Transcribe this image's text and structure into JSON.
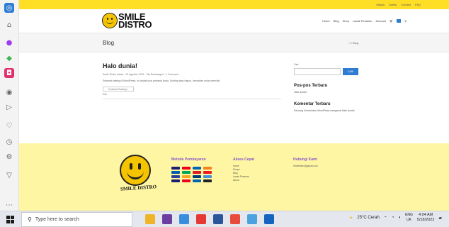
{
  "topbar": {
    "links": [
      "Masuk",
      "Daftar",
      "Contact",
      "FAQ"
    ]
  },
  "logo": {
    "text_line1": "SMILE",
    "text_line2": "DISTRO"
  },
  "nav": {
    "items": [
      "Home",
      "Blog",
      "Shop",
      "Lacak Pesanan",
      "Account"
    ],
    "cart_count": "0"
  },
  "page": {
    "title": "Blog",
    "breadcrumb": "⌂ / Blog"
  },
  "post": {
    "title": "Halo dunia!",
    "meta": "Smile Distro admin · 31 Agustus 2021 · Tak Berkategori · 1 Comment",
    "excerpt": "Selamat datang di WordPress. Ini adalah pos pertama Anda. Sunting atau hapus, kemudian mulai menulis!",
    "read_more": "Continue Reading »",
    "edit": "Edit"
  },
  "sidebar_widgets": {
    "search_label": "Cari",
    "search_button": "CARI",
    "recent_posts_title": "Pos-pos Terbaru",
    "recent_posts": [
      "Halo dunia!"
    ],
    "recent_comments_title": "Komentar Terbaru",
    "recent_comment": "Seorang Komentator WordPress mengenai Halo dunia!"
  },
  "footer": {
    "logo_text": "SMILE DISTRO",
    "payment_title": "Metode Pembayaran",
    "quick_title": "Akses Cepat",
    "quick_links": [
      "Home",
      "Shope",
      "Blog",
      "Lacak Pesanan",
      "About"
    ],
    "contact_title": "Hubungi Kami",
    "contact_email": "Smiledistro@gmail.com",
    "payment_colors": [
      "#1a1f71",
      "#eb001b",
      "#0066b3",
      "#f58220",
      "#005eab",
      "#00a651",
      "#e11b22",
      "#ed1c24",
      "#2c3e99",
      "#f5a623",
      "#003b7a",
      "#4a90d9",
      "#1a1f71",
      "#eb001b",
      "#0066b3",
      "#222222"
    ]
  },
  "browser_sidebar": {
    "icons": [
      "edge-icon",
      "home-icon",
      "messenger-icon",
      "bird-icon",
      "instagram-icon",
      "whatsapp-icon",
      "play-icon",
      "heart-icon",
      "clock-icon",
      "settings-icon",
      "pin-icon",
      "more-icon"
    ]
  },
  "taskbar": {
    "search_placeholder": "Type here to search",
    "weather": "25°C Cerah",
    "lang_line1": "ENG",
    "lang_line2": "UK",
    "time": "4:04 AM",
    "date": "5/18/2022",
    "app_colors": [
      "#f0b429",
      "#6b3fa0",
      "#3a8dde",
      "#e53935",
      "#2b579a",
      "#e84c3d",
      "#4aa3df",
      "#1565c0"
    ]
  }
}
